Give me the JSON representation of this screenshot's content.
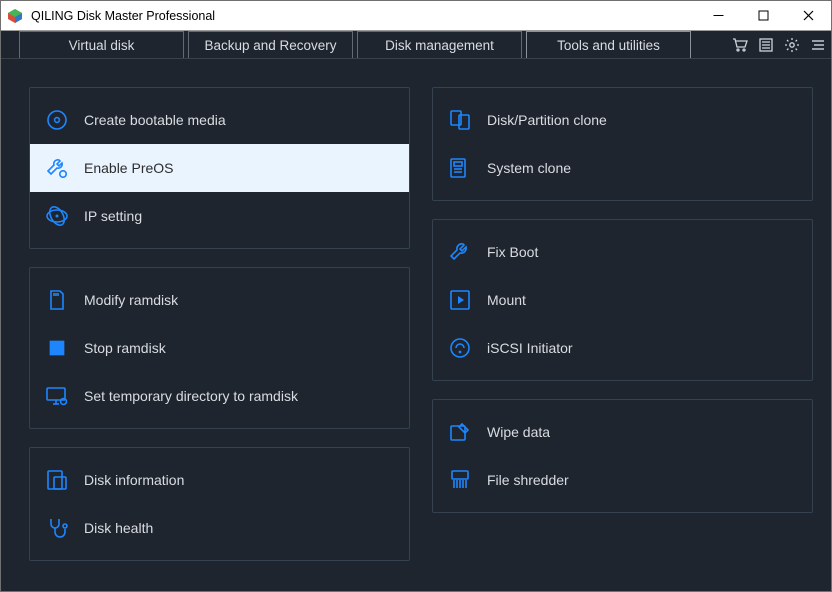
{
  "window": {
    "title": "QILING Disk Master Professional"
  },
  "tabs": [
    {
      "label": "Virtual disk"
    },
    {
      "label": "Backup and Recovery"
    },
    {
      "label": "Disk management"
    },
    {
      "label": "Tools and utilities"
    }
  ],
  "left": {
    "g1": [
      {
        "label": "Create bootable media"
      },
      {
        "label": "Enable PreOS"
      },
      {
        "label": "IP setting"
      }
    ],
    "g2": [
      {
        "label": "Modify ramdisk"
      },
      {
        "label": "Stop ramdisk"
      },
      {
        "label": "Set temporary directory to ramdisk"
      }
    ],
    "g3": [
      {
        "label": "Disk information"
      },
      {
        "label": "Disk health"
      }
    ]
  },
  "right": {
    "g1": [
      {
        "label": "Disk/Partition clone"
      },
      {
        "label": "System clone"
      }
    ],
    "g2": [
      {
        "label": "Fix Boot"
      },
      {
        "label": "Mount"
      },
      {
        "label": "iSCSI Initiator"
      }
    ],
    "g3": [
      {
        "label": "Wipe data"
      },
      {
        "label": "File shredder"
      }
    ]
  }
}
